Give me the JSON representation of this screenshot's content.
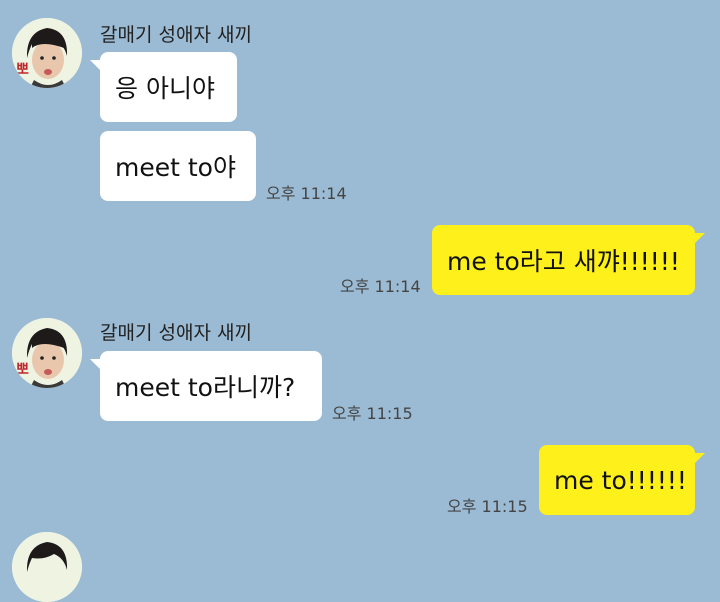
{
  "chat": {
    "messages": [
      {
        "sender": "갈매기 성애자 새끼",
        "text": "응 아니야"
      },
      {
        "text": "meet to야",
        "time": "오후 11:14"
      },
      {
        "text": "me to라고 새꺄!!!!!!",
        "time": "오후 11:14"
      },
      {
        "sender": "갈매기 성애자 새끼",
        "text": "meet to라니까?",
        "time": "오후 11:15"
      },
      {
        "text": "me to!!!!!!",
        "time": "오후 11:15"
      }
    ]
  },
  "colors": {
    "background": "#9bbbd4",
    "outgoing_bubble": "#fef01b",
    "incoming_bubble": "#ffffff"
  },
  "icons": {
    "avatar": "profile-avatar-icon"
  }
}
